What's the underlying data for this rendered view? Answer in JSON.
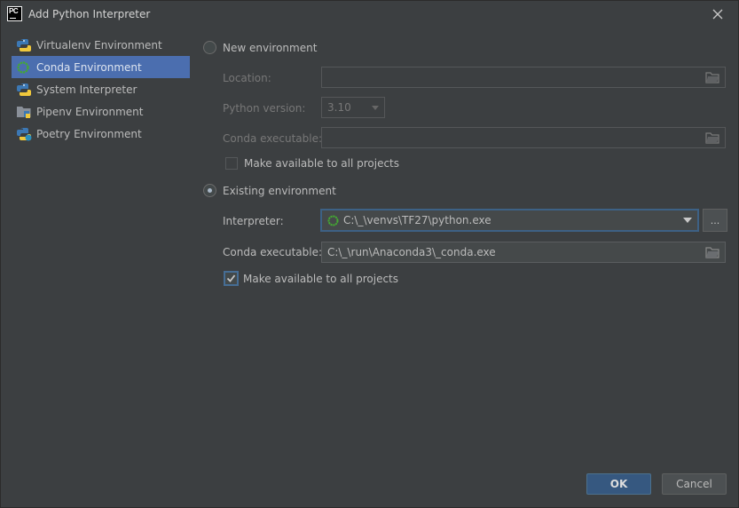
{
  "window": {
    "title": "Add Python Interpreter",
    "app_logo_text": "PC"
  },
  "sidebar": {
    "items": [
      {
        "label": "Virtualenv Environment",
        "icon": "python-icon",
        "selected": false
      },
      {
        "label": "Conda Environment",
        "icon": "conda-icon",
        "selected": true
      },
      {
        "label": "System Interpreter",
        "icon": "python-icon",
        "selected": false
      },
      {
        "label": "Pipenv Environment",
        "icon": "pipenv-icon",
        "selected": false
      },
      {
        "label": "Poetry Environment",
        "icon": "poetry-icon",
        "selected": false
      }
    ]
  },
  "new_env": {
    "radio_label": "New environment",
    "selected": false,
    "location_label": "Location:",
    "location_value": "",
    "python_version_label": "Python version:",
    "python_version_value": "3.10",
    "conda_exec_label": "Conda executable:",
    "conda_exec_value": "",
    "make_available_label": "Make available to all projects",
    "make_available_checked": false
  },
  "existing_env": {
    "radio_label": "Existing environment",
    "selected": true,
    "interpreter_label": "Interpreter:",
    "interpreter_value": "C:\\_\\venvs\\TF27\\python.exe",
    "browse_label": "...",
    "conda_exec_label": "Conda executable:",
    "conda_exec_value": "C:\\_\\run\\Anaconda3\\_conda.exe",
    "make_available_label": "Make available to all projects",
    "make_available_checked": true
  },
  "buttons": {
    "ok": "OK",
    "cancel": "Cancel"
  },
  "colors": {
    "background": "#3c3f41",
    "selection": "#4b6eaf",
    "accent_border": "#3d6185",
    "ok_button": "#365880"
  }
}
